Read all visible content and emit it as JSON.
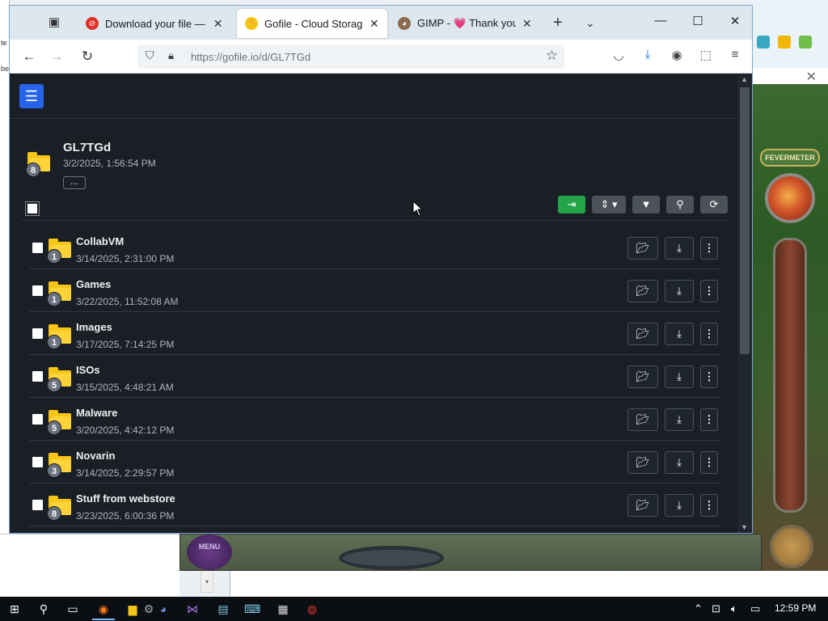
{
  "browser": {
    "tabs": [
      {
        "title": "Download your file — Ce",
        "favicon_color": "#e0322b"
      },
      {
        "title": "Gofile - Cloud Storage Ma",
        "favicon_color": "#f5c518",
        "active": true
      },
      {
        "title": "GIMP - 💗 Thank you for",
        "favicon_color": "#8a6a50"
      }
    ],
    "url": "https://gofile.io/d/GL7TGd"
  },
  "page": {
    "root": {
      "name": "GL7TGd",
      "date": "3/2/2025, 1:56:54 PM",
      "count": "8",
      "more_label": "..."
    },
    "folders": [
      {
        "name": "CollabVM",
        "date": "3/14/2025, 2:31:00 PM",
        "count": "1"
      },
      {
        "name": "Games",
        "date": "3/22/2025, 11:52:08 AM",
        "count": "1"
      },
      {
        "name": "Images",
        "date": "3/17/2025, 7:14:25 PM",
        "count": "1"
      },
      {
        "name": "ISOs",
        "date": "3/15/2025, 4:48:21 AM",
        "count": "5"
      },
      {
        "name": "Malware",
        "date": "3/20/2025, 4:42:12 PM",
        "count": "5"
      },
      {
        "name": "Novarin",
        "date": "3/14/2025, 2:29:57 PM",
        "count": "3"
      },
      {
        "name": "Stuff from webstore",
        "date": "3/23/2025, 6:00:36 PM",
        "count": "8"
      }
    ],
    "colors": {
      "menu_button": "#2563eb",
      "import_button": "#22a447",
      "folder": "#f5c518",
      "background": "#1a1f26"
    }
  },
  "background_game": {
    "fevermeter_label": "FEVERMETER",
    "menu_label": "MENU"
  },
  "taskbar": {
    "clock": "12:59 PM"
  }
}
